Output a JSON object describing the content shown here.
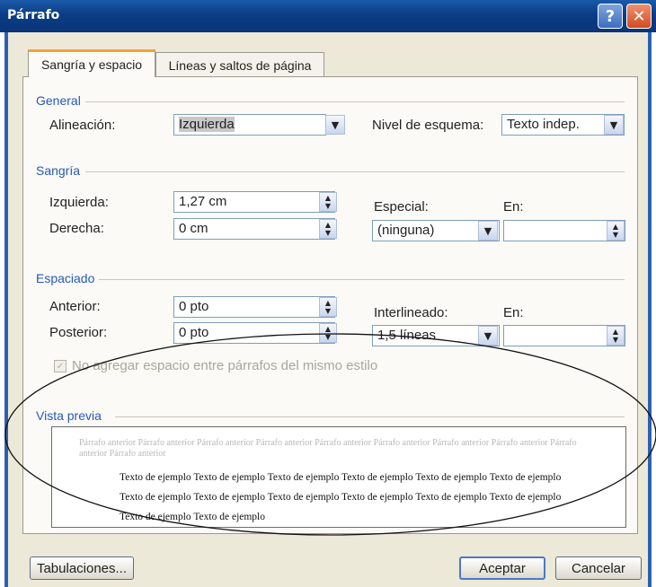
{
  "window": {
    "title": "Párrafo",
    "help_glyph": "?",
    "close_glyph": "✕"
  },
  "tabs": [
    {
      "label": "Sangría y espacio",
      "active": true
    },
    {
      "label": "Líneas y saltos de página",
      "active": false
    }
  ],
  "general": {
    "heading": "General",
    "alignment_label": "Alineación:",
    "alignment_value": "Izquierda",
    "outline_label": "Nivel de esquema:",
    "outline_value": "Texto indep."
  },
  "indent": {
    "heading": "Sangría",
    "left_label": "Izquierda:",
    "left_value": "1,27 cm",
    "right_label": "Derecha:",
    "right_value": "0 cm",
    "special_label": "Especial:",
    "special_value": "(ninguna)",
    "by_label": "En:",
    "by_value": ""
  },
  "spacing": {
    "heading": "Espaciado",
    "before_label": "Anterior:",
    "before_value": "0 pto",
    "after_label": "Posterior:",
    "after_value": "0 pto",
    "line_label": "Interlineado:",
    "line_value": "1,5 líneas",
    "at_label": "En:",
    "at_value": "",
    "no_space_checkbox_label": "No agregar espacio entre párrafos del mismo estilo"
  },
  "preview": {
    "heading": "Vista previa",
    "prev_paragraph": "Párrafo anterior Párrafo anterior Párrafo anterior Párrafo anterior Párrafo anterior Párrafo anterior Párrafo anterior Párrafo anterior Párrafo anterior Párrafo anterior",
    "sample_text": "Texto de ejemplo Texto de ejemplo Texto de ejemplo Texto de ejemplo Texto de ejemplo Texto de ejemplo Texto de ejemplo Texto de ejemplo Texto de ejemplo Texto de ejemplo Texto de ejemplo Texto de ejemplo Texto de ejemplo Texto de ejemplo"
  },
  "buttons": {
    "tabs": "Tabulaciones...",
    "ok": "Aceptar",
    "cancel": "Cancelar"
  },
  "colors": {
    "title_bar": "#0b3d86",
    "group_heading": "#2659b5",
    "dialog_bg": "#ece9d8",
    "active_tab_accent": "#f3a33a"
  }
}
